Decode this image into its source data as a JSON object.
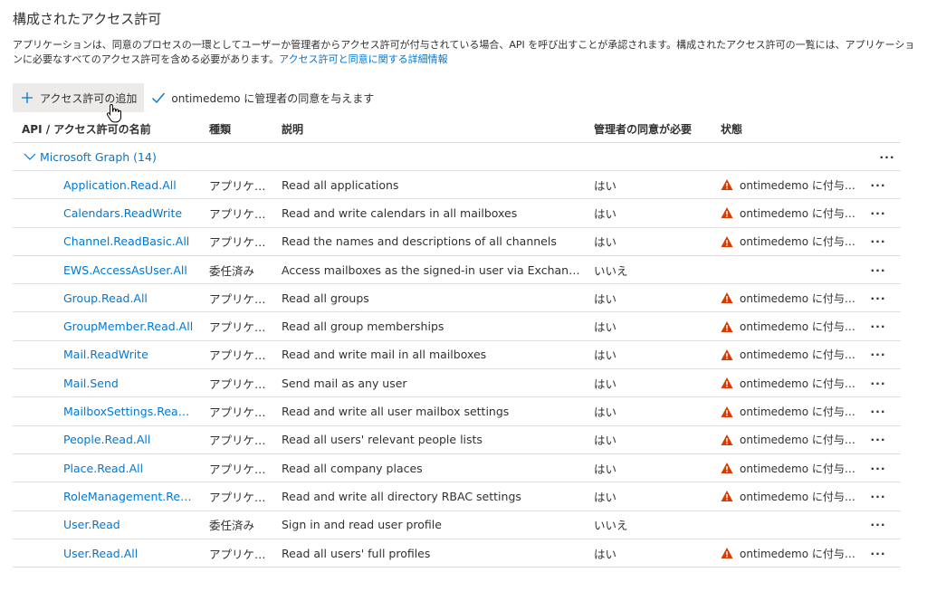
{
  "page": {
    "title": "構成されたアクセス許可",
    "description": "アプリケーションは、同意のプロセスの一環としてユーザーか管理者からアクセス許可が付与されている場合、API を呼び出すことが承認されます。構成されたアクセス許可の一覧には、アプリケーションに必要なすべてのアクセス許可を含める必要があります。",
    "learn_more_link": "アクセス許可と同意に関する詳細情報"
  },
  "toolbar": {
    "add_permission_label": "アクセス許可の追加",
    "grant_consent_label": "ontimedemo に管理者の同意を与えます",
    "add_icon": "plus-icon",
    "grant_icon": "checkmark-icon"
  },
  "table": {
    "columns": {
      "name": "API / アクセス許可の名前",
      "type": "種類",
      "description": "説明",
      "admin_consent": "管理者の同意が必要",
      "status": "状態"
    },
    "group": {
      "label": "Microsoft Graph (14)",
      "more": "···"
    },
    "rows": [
      {
        "name": "Application.Read.All",
        "type": "アプリケー…",
        "description": "Read all applications",
        "admin": "はい",
        "status": "ontimedemo に付与さ…",
        "more": "···"
      },
      {
        "name": "Calendars.ReadWrite",
        "type": "アプリケー…",
        "description": "Read and write calendars in all mailboxes",
        "admin": "はい",
        "status": "ontimedemo に付与さ…",
        "more": "···"
      },
      {
        "name": "Channel.ReadBasic.All",
        "type": "アプリケー…",
        "description": "Read the names and descriptions of all channels",
        "admin": "はい",
        "status": "ontimedemo に付与さ…",
        "more": "···"
      },
      {
        "name": "EWS.AccessAsUser.All",
        "type": "委任済み",
        "description": "Access mailboxes as the signed-in user via Exchang…",
        "admin": "いいえ",
        "status": "",
        "more": "···"
      },
      {
        "name": "Group.Read.All",
        "type": "アプリケー…",
        "description": "Read all groups",
        "admin": "はい",
        "status": "ontimedemo に付与さ…",
        "more": "···"
      },
      {
        "name": "GroupMember.Read.All",
        "type": "アプリケー…",
        "description": "Read all group memberships",
        "admin": "はい",
        "status": "ontimedemo に付与さ…",
        "more": "···"
      },
      {
        "name": "Mail.ReadWrite",
        "type": "アプリケー…",
        "description": "Read and write mail in all mailboxes",
        "admin": "はい",
        "status": "ontimedemo に付与さ…",
        "more": "···"
      },
      {
        "name": "Mail.Send",
        "type": "アプリケー…",
        "description": "Send mail as any user",
        "admin": "はい",
        "status": "ontimedemo に付与さ…",
        "more": "···"
      },
      {
        "name": "MailboxSettings.ReadWrite",
        "type": "アプリケー…",
        "description": "Read and write all user mailbox settings",
        "admin": "はい",
        "status": "ontimedemo に付与さ…",
        "more": "···"
      },
      {
        "name": "People.Read.All",
        "type": "アプリケー…",
        "description": "Read all users' relevant people lists",
        "admin": "はい",
        "status": "ontimedemo に付与さ…",
        "more": "···"
      },
      {
        "name": "Place.Read.All",
        "type": "アプリケー…",
        "description": "Read all company places",
        "admin": "はい",
        "status": "ontimedemo に付与さ…",
        "more": "···"
      },
      {
        "name": "RoleManagement.ReadWri",
        "type": "アプリケー…",
        "description": "Read and write all directory RBAC settings",
        "admin": "はい",
        "status": "ontimedemo に付与さ…",
        "more": "···"
      },
      {
        "name": "User.Read",
        "type": "委任済み",
        "description": "Sign in and read user profile",
        "admin": "いいえ",
        "status": "",
        "more": "···"
      },
      {
        "name": "User.Read.All",
        "type": "アプリケー…",
        "description": "Read all users' full profiles",
        "admin": "はい",
        "status": "ontimedemo に付与さ…",
        "more": "···"
      }
    ]
  },
  "colors": {
    "link": "#0078d4",
    "warning": "#d83b01",
    "border": "#e1dfdd",
    "hover": "#edebe9"
  }
}
